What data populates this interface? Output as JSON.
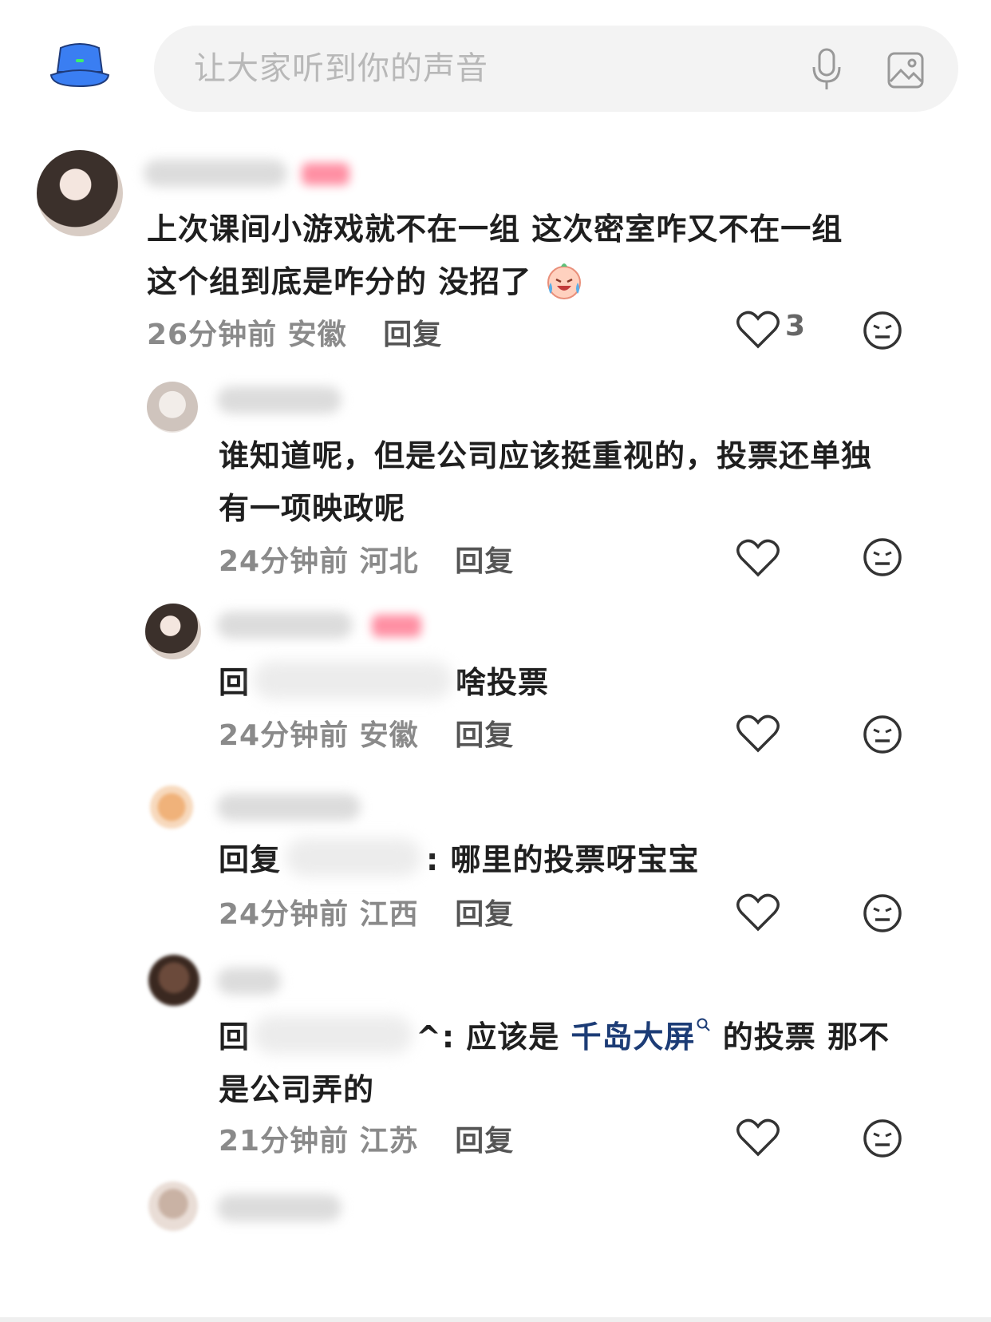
{
  "composer": {
    "placeholder": "让大家听到你的声音",
    "mic_icon": "mic-icon",
    "image_icon": "image-icon"
  },
  "comments": [
    {
      "text_lines": [
        "上次课间小游戏就不在一组 这次密室咋又不在一组",
        "这个组到底是咋分的 没招了"
      ],
      "emoji": "crying-laughing-emoji",
      "time": "26分钟前",
      "location": "安徽",
      "reply_label": "回复",
      "likes": "3"
    },
    {
      "text_lines": [
        "谁知道呢，但是公司应该挺重视的，投票还单独",
        "有一项映政呢"
      ],
      "time": "24分钟前",
      "location": "河北",
      "reply_label": "回复",
      "likes": ""
    },
    {
      "text_prefix": "回",
      "text_suffix": "啥投票",
      "time": "24分钟前",
      "location": "安徽",
      "reply_label": "回复",
      "likes": ""
    },
    {
      "text_prefix": "回复",
      "text_suffix": ": 哪里的投票呀宝宝",
      "time": "24分钟前",
      "location": "江西",
      "reply_label": "回复",
      "likes": ""
    },
    {
      "text_prefix": "回",
      "text_mid": "^: 应该是 ",
      "link": "千岛大屏",
      "text_after": " 的投票  那不",
      "text_line2": "是公司弄的",
      "time": "21分钟前",
      "location": "江苏",
      "reply_label": "回复",
      "likes": ""
    }
  ],
  "colors": {
    "link": "#1c3c76",
    "meta": "#8a8a8a",
    "composer_bg": "#f3f3f3"
  }
}
